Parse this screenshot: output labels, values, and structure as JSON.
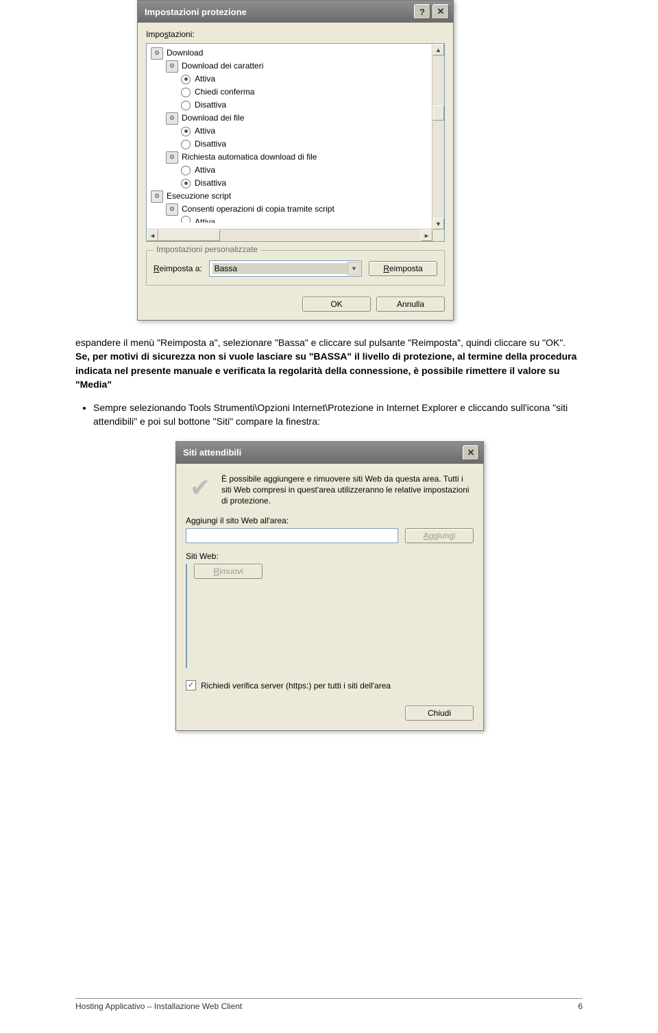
{
  "dlg1": {
    "title": "Impostazioni protezione",
    "settings_label": "Impostazioni:",
    "tree": [
      {
        "level": 1,
        "type": "cat",
        "text": "Download"
      },
      {
        "level": 2,
        "type": "cat",
        "text": "Download dei caratteri"
      },
      {
        "level": 3,
        "type": "radio",
        "selected": true,
        "text": "Attiva"
      },
      {
        "level": 3,
        "type": "radio",
        "selected": false,
        "text": "Chiedi conferma"
      },
      {
        "level": 3,
        "type": "radio",
        "selected": false,
        "text": "Disattiva"
      },
      {
        "level": 2,
        "type": "cat",
        "text": "Download dei file"
      },
      {
        "level": 3,
        "type": "radio",
        "selected": true,
        "text": "Attiva"
      },
      {
        "level": 3,
        "type": "radio",
        "selected": false,
        "text": "Disattiva"
      },
      {
        "level": 2,
        "type": "cat",
        "text": "Richiesta automatica download di file"
      },
      {
        "level": 3,
        "type": "radio",
        "selected": false,
        "text": "Attiva"
      },
      {
        "level": 3,
        "type": "radio",
        "selected": true,
        "text": "Disattiva"
      },
      {
        "level": 1,
        "type": "cat",
        "text": "Esecuzione script"
      },
      {
        "level": 2,
        "type": "cat",
        "text": "Consenti operazioni di copia tramite script"
      },
      {
        "level": 3,
        "type": "radio-partial",
        "selected": false,
        "text": "Attiva"
      }
    ],
    "custom_legend": "Impostazioni personalizzate",
    "reset_label": "Reimposta a:",
    "reset_value": "Bassa",
    "reset_button": "Reimposta",
    "ok": "OK",
    "cancel": "Annulla"
  },
  "paragraph1": "espandere il menù \"Reimposta a\", selezionare \"Bassa\" e cliccare sul pulsante \"Reimposta\", quindi cliccare su \"OK\". Se, per motivi di sicurezza non si vuole lasciare su \"BASSA\" il livello di protezione, al termine della procedura indicata nel presente manuale e verificata la regolarità della connessione, è possibile rimettere il valore su \"Media\"",
  "bullet1": "Sempre selezionando Tools Strumenti\\Opzioni Internet\\Protezione in Internet Explorer e cliccando sull'icona \"siti attendibili\" e poi sul bottone \"Siti\" compare la finestra:",
  "dlg2": {
    "title": "Siti attendibili",
    "intro": "È possibile aggiungere e rimuovere siti Web da questa area. Tutti i siti Web compresi in quest'area utilizzeranno le relative impostazioni di protezione.",
    "add_label": "Aggiungi il sito Web all'area:",
    "add_button": "Aggiungi",
    "list_label": "Siti Web:",
    "remove_button": "Rimuovi",
    "checkbox_label": "Richiedi verifica server (https:) per tutti i siti dell'area",
    "close": "Chiudi"
  },
  "footer": {
    "left": "Hosting Applicativo – Installazione Web Client",
    "right": "6"
  }
}
